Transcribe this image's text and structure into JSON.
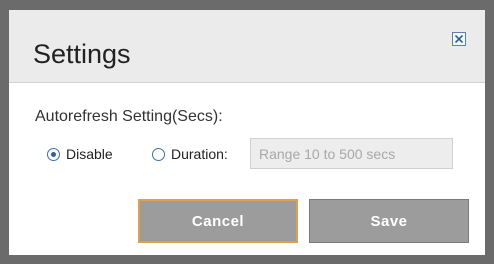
{
  "dialog": {
    "title": "Settings",
    "close_icon": "close-icon",
    "section_label": "Autorefresh Setting(Secs):",
    "options": {
      "disable": {
        "label": "Disable",
        "checked": true
      },
      "duration": {
        "label": "Duration:",
        "checked": false,
        "value": "",
        "placeholder": "Range 10 to 500 secs"
      }
    },
    "buttons": {
      "cancel": "Cancel",
      "save": "Save"
    }
  },
  "colors": {
    "overlay": "#6b6b6b",
    "titlebar": "#ebebeb",
    "button": "#9c9c9c",
    "focus_border": "#e0a04a",
    "radio": "#3b6fb0"
  }
}
